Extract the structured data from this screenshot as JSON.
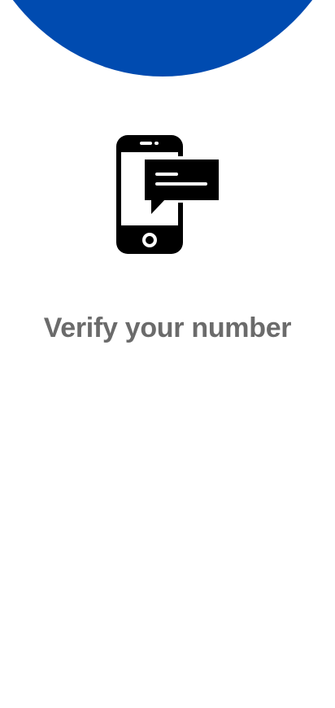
{
  "colors": {
    "header_arc": "#004BB0",
    "title_text": "#6b6b6b",
    "icon": "#000000",
    "background": "#ffffff"
  },
  "illustration": {
    "icon": "phone-sms-icon"
  },
  "title": "Verify your number"
}
